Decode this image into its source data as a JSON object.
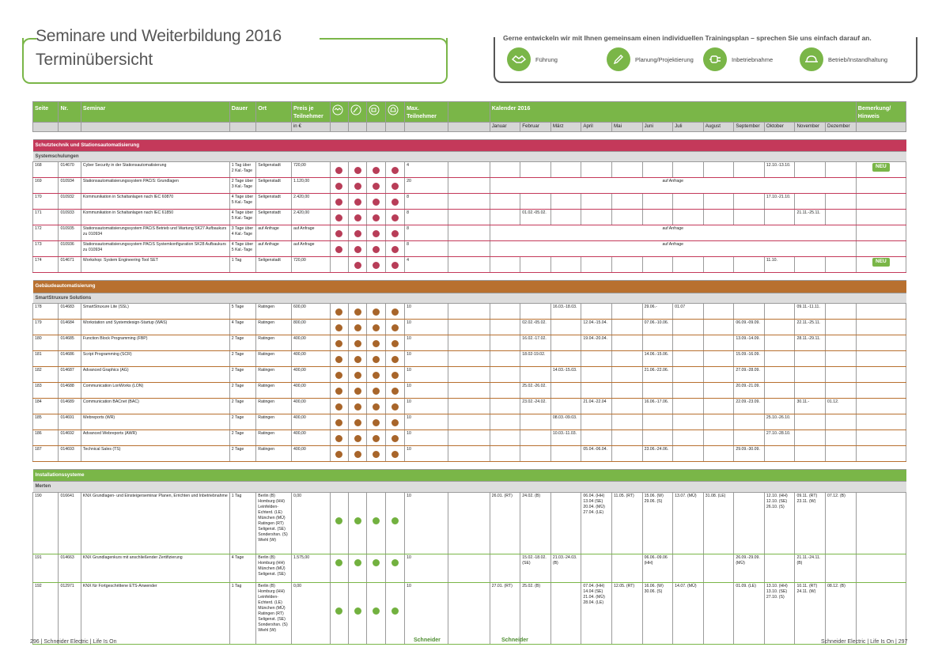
{
  "title": {
    "line1": "Seminare und Weiterbildung 2016",
    "line2": "Terminübersicht"
  },
  "legend": {
    "text": "Gerne entwickeln wir mit Ihnen gemeinsam einen individuellen Trainingsplan – sprechen Sie uns einfach darauf an.",
    "items": [
      {
        "label": "Führung",
        "icon": "handshake-icon"
      },
      {
        "label": "Planung/Projektierung",
        "icon": "pencil-icon"
      },
      {
        "label": "Inbetriebnahme",
        "icon": "plug-icon"
      },
      {
        "label": "Betrieb/Instandhaltung",
        "icon": "helmet-icon"
      }
    ]
  },
  "colors": {
    "green": "#7ab648",
    "red": "#c4395a",
    "brown": "#b8702f",
    "dot_red": "#b83d58",
    "dot_brown": "#a8652a",
    "dot_green": "#72b13f"
  },
  "table": {
    "headers": {
      "seite": "Seite",
      "nr": "Nr.",
      "seminar": "Seminar",
      "dauer": "Dauer",
      "ort": "Ort",
      "preis": "Preis je Teilnehmer",
      "preis_unit": "in €",
      "max": "Max. Teilnehmer",
      "kalender": "Kalender 2016",
      "bemerkung": "Bemerkung/ Hinweis"
    },
    "months": [
      "Januar",
      "Februar",
      "März",
      "April",
      "Mai",
      "Juni",
      "Juli",
      "August",
      "September",
      "Oktober",
      "November",
      "Dezember"
    ],
    "neu_label": "NEU",
    "sections": [
      {
        "title": "Schutztechnik und Stationsautomatisierung",
        "color": "red",
        "group": "Systemschulungen",
        "rows": [
          {
            "seite": "168",
            "nr": "014670",
            "seminar": "Cyber Security in der Stationsautomatisierung",
            "dauer": "1 Tag über 2 Kal.-Tage",
            "ort": "Seligenstadt",
            "preis": "720,00",
            "dots": [
              1,
              1,
              1,
              1
            ],
            "max": "4",
            "months": {
              "10": "12.10.-13.10."
            },
            "neu": true
          },
          {
            "seite": "169",
            "nr": "010934",
            "seminar": "Stationsautomatisierungssystem PACiS: Grundlagen",
            "dauer": "2 Tage über 3 Kal.-Tage",
            "ort": "Seligenstadt",
            "preis": "1.120,00",
            "dots": [
              1,
              1,
              1,
              1
            ],
            "max": "20",
            "span": "auf Anfrage"
          },
          {
            "seite": "170",
            "nr": "010932",
            "seminar": "Kommunikation in Schaltanlagen nach IEC 60870",
            "dauer": "4 Tage über 5 Kal.-Tage",
            "ort": "Seligenstadt",
            "preis": "2.420,00",
            "dots": [
              1,
              1,
              1,
              1
            ],
            "max": "8",
            "months": {
              "10": "17.10.-21.10."
            }
          },
          {
            "seite": "171",
            "nr": "010933",
            "seminar": "Kommunikation in Schaltanlagen nach IEC 61850",
            "dauer": "4 Tage über 5 Kal.-Tage",
            "ort": "Seligenstadt",
            "preis": "2.420,00",
            "dots": [
              1,
              1,
              1,
              1
            ],
            "max": "8",
            "months": {
              "2": "01.02.-05.02.",
              "11": "21.11.-25.11."
            }
          },
          {
            "seite": "172",
            "nr": "010935",
            "seminar": "Stationsautomatisierungssystem PACiS Betrieb und Wartung SK27 Aufbaukurs zu 010934",
            "dauer": "3 Tage über 4 Kal.-Tage",
            "ort": "auf Anfrage",
            "preis": "auf Anfrage",
            "dots": [
              1,
              1,
              1,
              1
            ],
            "max": "8",
            "span": "auf Anfrage"
          },
          {
            "seite": "173",
            "nr": "010936",
            "seminar": "Stationsautomatisierungssystem PACiS Systemkonfiguration SK28 Aufbaukurs zu 010934",
            "dauer": "4 Tage über 5 Kal.-Tage",
            "ort": "auf Anfrage",
            "preis": "auf Anfrage",
            "dots": [
              1,
              1,
              1,
              1
            ],
            "max": "8",
            "span": "auf Anfrage"
          },
          {
            "seite": "174",
            "nr": "014671",
            "seminar": "Workshop: System Engineering Tool SET",
            "dauer": "1 Tag",
            "ort": "Seligenstadt",
            "preis": "720,00",
            "dots": [
              0,
              1,
              1,
              1
            ],
            "max": "4",
            "months": {
              "10": "11.10."
            },
            "neu": true
          }
        ]
      },
      {
        "title": "Gebäudeautomatisierung",
        "color": "brown",
        "group": "SmartStruxure Solutions",
        "rows": [
          {
            "seite": "178",
            "nr": "014683",
            "seminar": "SmartStruxure Lite (SSL)",
            "dauer": "5 Tage",
            "ort": "Ratingen",
            "preis": "600,00",
            "dots": [
              1,
              1,
              1,
              1
            ],
            "max": "10",
            "months": {
              "3": "16.03.-18.03.",
              "6": "29.06.-",
              "7": "01.07",
              "11": "09.11.-11.11."
            }
          },
          {
            "seite": "179",
            "nr": "014684",
            "seminar": "Workstation und Systemdesign-Startup (WAS)",
            "dauer": "4 Tage",
            "ort": "Ratingen",
            "preis": "800,00",
            "dots": [
              1,
              1,
              1,
              1
            ],
            "max": "10",
            "months": {
              "2": "02.02.-05.02.",
              "4": "12.04.-15.04.",
              "6": "07.06.-10.06.",
              "9": "06.09.-09.09.",
              "11": "22.11.-25.11."
            }
          },
          {
            "seite": "180",
            "nr": "014685",
            "seminar": "Function Block Programming (FBP)",
            "dauer": "2 Tage",
            "ort": "Ratingen",
            "preis": "400,00",
            "dots": [
              1,
              1,
              1,
              1
            ],
            "max": "10",
            "months": {
              "2": "16.02.-17.02.",
              "4": "19.04.-20.04.",
              "9": "13.09.-14.09.",
              "11": "28.11.-29.11."
            }
          },
          {
            "seite": "181",
            "nr": "014686",
            "seminar": "Script Programming (SCR)",
            "dauer": "2 Tage",
            "ort": "Ratingen",
            "preis": "400,00",
            "dots": [
              1,
              1,
              1,
              1
            ],
            "max": "10",
            "months": {
              "2": "18.02-19.02.",
              "6": "14.06.-15.06.",
              "9": "15.09.-16.09."
            }
          },
          {
            "seite": "182",
            "nr": "014687",
            "seminar": "Advanced Graphics (AG)",
            "dauer": "2 Tage",
            "ort": "Ratingen",
            "preis": "400,00",
            "dots": [
              1,
              1,
              1,
              1
            ],
            "max": "10",
            "months": {
              "3": "14.03.-15.03.",
              "6": "21.06.-22.06.",
              "9": "27.09.-28.09."
            }
          },
          {
            "seite": "183",
            "nr": "014688",
            "seminar": "Communication LonWorks (LON)",
            "dauer": "2 Tage",
            "ort": "Ratingen",
            "preis": "400,00",
            "dots": [
              1,
              1,
              1,
              1
            ],
            "max": "10",
            "months": {
              "2": "25.02.-26.02.",
              "9": "20.09.-21.09."
            }
          },
          {
            "seite": "184",
            "nr": "014689",
            "seminar": "Communication BACnet (BAC)",
            "dauer": "2 Tage",
            "ort": "Ratingen",
            "preis": "400,00",
            "dots": [
              1,
              1,
              1,
              1
            ],
            "max": "10",
            "months": {
              "2": "23.02.-24.02.",
              "4": "21.04.-22.04",
              "6": "16.06.-17.06.",
              "9": "22.09.-23.09.",
              "11": "30.11.-",
              "12": "01.12."
            }
          },
          {
            "seite": "185",
            "nr": "014691",
            "seminar": "Webreports (WR)",
            "dauer": "2 Tage",
            "ort": "Ratingen",
            "preis": "400,00",
            "dots": [
              1,
              1,
              1,
              1
            ],
            "max": "10",
            "months": {
              "3": "08.03.-09.03.",
              "10": "25.10.-26.10."
            }
          },
          {
            "seite": "186",
            "nr": "014692",
            "seminar": "Advanced Webreports (AWR)",
            "dauer": "2 Tage",
            "ort": "Ratingen",
            "preis": "400,00",
            "dots": [
              1,
              1,
              1,
              1
            ],
            "max": "10",
            "months": {
              "3": "10.03.-11.03.",
              "10": "27.10.-28.10."
            }
          },
          {
            "seite": "187",
            "nr": "014693",
            "seminar": "Technical Sales (TS)",
            "dauer": "2 Tage",
            "ort": "Ratingen",
            "preis": "400,00",
            "dots": [
              1,
              1,
              1,
              1
            ],
            "max": "10",
            "months": {
              "4": "05.04.-06.04.",
              "6": "23.06.-24.06.",
              "9": "29.09.-30.09."
            }
          }
        ]
      },
      {
        "title": "Installationssysteme",
        "color": "green",
        "group": "Merten",
        "rows": [
          {
            "seite": "190",
            "nr": "016641",
            "seminar": "KNX Grundlagen- und Einsteigerseminar Planen, Errichten und Inbetriebnahme",
            "dauer": "1 Tag",
            "ort": "Berlin (B) Homburg (HH) Leinfelden-Echterd. (LE) München (MÜ) Ratingen (RT) Seligenst. (SE) Sondershsn. (S) Wiehl (W)",
            "preis": "0,00",
            "dots": [
              1,
              1,
              1,
              1
            ],
            "max": "10",
            "tall": true,
            "months": {
              "1": "26.01. (RT)",
              "2": "24.02. (B)",
              "4": "06.04. (HH) 13.04 (SE) 20.04. (MÜ) 27.04. (LE)",
              "5": "11.05. (RT)",
              "6": "15.06. (W) 29.06. (S)",
              "7": "13.07. (MÜ)",
              "8": "31.08. (LE)",
              "10": "12.10. (HH) 12.10. (SE) 26.10. (S)",
              "11": "09.11. (RT) 23.11. (W)",
              "12": "07.12. (B)"
            }
          },
          {
            "seite": "191",
            "nr": "014663",
            "seminar": "KNX Grundlagenkurs mit anschließender Zertifizierung",
            "dauer": "4 Tage",
            "ort": "Berlin (B) Homburg (HH) München (MÜ) Seligenst. (SE)",
            "preis": "1.575,00",
            "dots": [
              1,
              1,
              1,
              1
            ],
            "max": "10",
            "months": {
              "2": "15.02.-18.02. (SE)",
              "3": "21.03.-24.03. (B)",
              "6": "06.06.-09.06 (HH)",
              "9": "26.09.-29.09. (MÜ)",
              "11": "21.11.-24.11. (B)"
            }
          },
          {
            "seite": "192",
            "nr": "012971",
            "seminar": "KNX für Fortgeschrittene ETS-Anwender",
            "dauer": "1 Tag",
            "ort": "Berlin (B) Homburg (HH) Leinfelden-Echterd. (LE) München (MÜ) Ratingen (RT) Seligenst. (SE) Sondershsn. (S) Wiehl (W)",
            "preis": "0,00",
            "dots": [
              1,
              1,
              1,
              1
            ],
            "max": "10",
            "tall": true,
            "months": {
              "1": "27.01. (RT)",
              "2": "25.02. (B)",
              "4": "07.04. (HH) 14.04 (SE) 21.04. (MÜ) 28.04. (LE)",
              "5": "12.05. (RT)",
              "6": "16.06. (W) 30.06. (S)",
              "7": "14.07. (MÜ)",
              "9": "01.09. (LE)",
              "10": "13.10. (HH) 13.10. (SE) 27.10. (S)",
              "11": "10.11. (RT) 24.11. (W)",
              "12": "08.12. (B)"
            }
          }
        ]
      }
    ]
  },
  "footer": {
    "left": "296 | Schneider Electric | Life Is On",
    "right": "Schneider Electric | Life Is On | 297",
    "logo": "Schneider"
  }
}
